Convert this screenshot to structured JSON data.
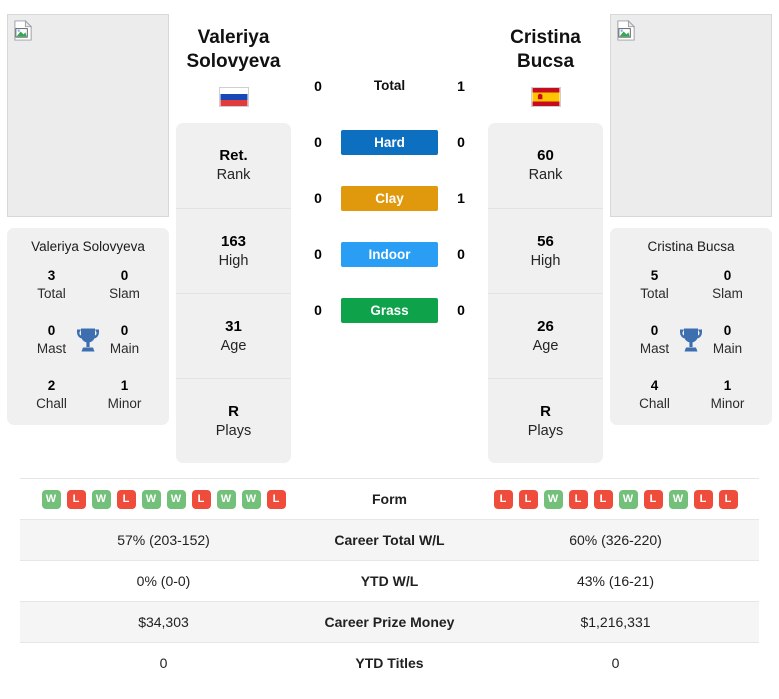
{
  "colors": {
    "hard": "#0d6fbf",
    "clay": "#e0980c",
    "indoor": "#2a9df4",
    "grass": "#0ea34a",
    "win": "#72c07a",
    "loss": "#ef4c3c",
    "trophy": "#3d6fb0",
    "card_bg": "#f0f0f0",
    "row_alt_bg": "#f5f5f5"
  },
  "players": {
    "left": {
      "name_line1": "Valeriya",
      "name_line2": "Solovyeva",
      "full_name": "Valeriya Solovyeva",
      "flag": "russia-flag",
      "photo": "broken-image-placeholder",
      "stats": [
        {
          "value": "Ret.",
          "label": "Rank"
        },
        {
          "value": "163",
          "label": "High"
        },
        {
          "value": "31",
          "label": "Age"
        },
        {
          "value": "R",
          "label": "Plays"
        }
      ],
      "titles": [
        {
          "value": "3",
          "label": "Total"
        },
        {
          "value": "0",
          "label": "Slam"
        },
        {
          "value": "0",
          "label": "Mast"
        },
        {
          "value": "0",
          "label": "Main"
        },
        {
          "value": "2",
          "label": "Chall"
        },
        {
          "value": "1",
          "label": "Minor"
        }
      ],
      "form": [
        "W",
        "L",
        "W",
        "L",
        "W",
        "W",
        "L",
        "W",
        "W",
        "L"
      ],
      "career_total_wl": "57% (203-152)",
      "ytd_wl": "0% (0-0)",
      "career_prize_money": "$34,303",
      "ytd_titles": "0"
    },
    "right": {
      "name_line1": "Cristina",
      "name_line2": "Bucsa",
      "full_name": "Cristina Bucsa",
      "flag": "spain-flag",
      "photo": "broken-image-placeholder",
      "stats": [
        {
          "value": "60",
          "label": "Rank"
        },
        {
          "value": "56",
          "label": "High"
        },
        {
          "value": "26",
          "label": "Age"
        },
        {
          "value": "R",
          "label": "Plays"
        }
      ],
      "titles": [
        {
          "value": "5",
          "label": "Total"
        },
        {
          "value": "0",
          "label": "Slam"
        },
        {
          "value": "0",
          "label": "Mast"
        },
        {
          "value": "0",
          "label": "Main"
        },
        {
          "value": "4",
          "label": "Chall"
        },
        {
          "value": "1",
          "label": "Minor"
        }
      ],
      "form": [
        "L",
        "L",
        "W",
        "L",
        "L",
        "W",
        "L",
        "W",
        "L",
        "L"
      ],
      "career_total_wl": "60% (326-220)",
      "ytd_wl": "43% (16-21)",
      "career_prize_money": "$1,216,331",
      "ytd_titles": "0"
    }
  },
  "head_to_head": [
    {
      "surface": "Total",
      "type": "plain",
      "left": "0",
      "right": "1"
    },
    {
      "surface": "Hard",
      "type": "badge",
      "left": "0",
      "right": "0"
    },
    {
      "surface": "Clay",
      "type": "badge",
      "left": "0",
      "right": "1"
    },
    {
      "surface": "Indoor",
      "type": "badge",
      "left": "0",
      "right": "0"
    },
    {
      "surface": "Grass",
      "type": "badge",
      "left": "0",
      "right": "0"
    }
  ],
  "table": {
    "rows": [
      {
        "label": "Form",
        "kind": "form"
      },
      {
        "label": "Career Total W/L",
        "kind": "text"
      },
      {
        "label": "YTD W/L",
        "kind": "text"
      },
      {
        "label": "Career Prize Money",
        "kind": "text"
      },
      {
        "label": "YTD Titles",
        "kind": "text"
      }
    ]
  }
}
